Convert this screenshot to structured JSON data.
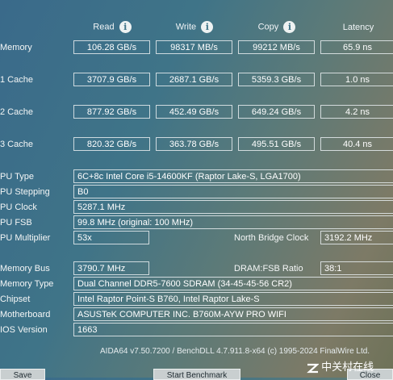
{
  "columns": [
    {
      "label": "Read",
      "has_info": true
    },
    {
      "label": "Write",
      "has_info": true
    },
    {
      "label": "Copy",
      "has_info": true
    },
    {
      "label": "Latency",
      "has_info": false
    }
  ],
  "bench_rows": [
    {
      "label": "Memory",
      "read": "106.28 GB/s",
      "write": "98317 MB/s",
      "copy": "99212 MB/s",
      "latency": "65.9 ns"
    },
    {
      "label": "1 Cache",
      "read": "3707.9 GB/s",
      "write": "2687.1 GB/s",
      "copy": "5359.3 GB/s",
      "latency": "1.0 ns"
    },
    {
      "label": "2 Cache",
      "read": "877.92 GB/s",
      "write": "452.49 GB/s",
      "copy": "649.24 GB/s",
      "latency": "4.2 ns"
    },
    {
      "label": "3 Cache",
      "read": "820.32 GB/s",
      "write": "363.78 GB/s",
      "copy": "495.51 GB/s",
      "latency": "40.4 ns"
    }
  ],
  "cpu": {
    "type_label": "PU Type",
    "type_value": "6C+8c Intel Core i5-14600KF  (Raptor Lake-S, LGA1700)",
    "stepping_label": "PU Stepping",
    "stepping_value": "B0",
    "clock_label": "PU Clock",
    "clock_value": "5287.1 MHz",
    "fsb_label": "PU FSB",
    "fsb_value": "99.8 MHz  (original: 100 MHz)",
    "multiplier_label": "PU Multiplier",
    "multiplier_value": "53x",
    "nb_clock_label": "North Bridge Clock",
    "nb_clock_value": "3192.2 MHz"
  },
  "memory": {
    "bus_label": "Memory Bus",
    "bus_value": "3790.7 MHz",
    "ratio_label": "DRAM:FSB Ratio",
    "ratio_value": "38:1",
    "type_label": "Memory Type",
    "type_value": "Dual Channel DDR5-7600 SDRAM  (34-45-45-56 CR2)",
    "chipset_label": "Chipset",
    "chipset_value": "Intel Raptor Point-S B760, Intel Raptor Lake-S",
    "motherboard_label": "Motherboard",
    "motherboard_value": "ASUSTeK COMPUTER INC. B760M-AYW PRO WIFI",
    "bios_label": "IOS Version",
    "bios_value": "1663"
  },
  "footer": "AIDA64 v7.50.7200 / BenchDLL 4.7.911.8-x64  (c) 1995-2024 FinalWire Ltd.",
  "buttons": {
    "save": "Save",
    "start": "Start Benchmark",
    "close": "Close"
  },
  "watermark": "中关村在线",
  "colors": {
    "background_start": "#3a6a8a",
    "background_end": "#7d7a66",
    "box_border": "#e6ecee",
    "info_icon": "#eef2f2"
  }
}
